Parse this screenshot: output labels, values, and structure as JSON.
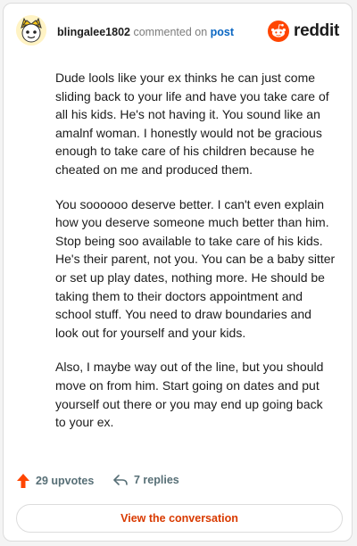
{
  "header": {
    "username": "blingalee1802",
    "action": "commented on",
    "post_link": "post",
    "brand": "reddit"
  },
  "comment": {
    "paragraphs": [
      "Dude lools like your ex thinks he can just come sliding back to your life and have you take care of all his kids. He's not having it. You sound like an amalnf woman. I honestly would not be gracious enough to take care of his children because he cheated on me and produced them.",
      "You soooooo deserve better. I can't even explain how you deserve someone much better than him. Stop being soo available to take care of his kids. He's their parent, not you. You can be a baby sitter or set up play dates, nothing more. He should be taking them to their doctors appointment and school stuff. You need to draw boundaries and look out for yourself and your kids.",
      "Also, I maybe way out of the line, but you should move on from him. Start going on dates and put yourself out there or you may end up going back to your ex."
    ]
  },
  "footer": {
    "upvotes": "29 upvotes",
    "replies": "7 replies"
  },
  "button": {
    "label": "View the conversation"
  },
  "colors": {
    "brand": "#ff4500",
    "link": "#0a66c2",
    "button_text": "#d93a00",
    "upvote_arrow": "#ff4500"
  },
  "icons": {
    "avatar": "snoo-avatar",
    "logo": "reddit-alien-icon",
    "upvote": "upvote-arrow-icon",
    "reply": "reply-arrow-icon"
  }
}
